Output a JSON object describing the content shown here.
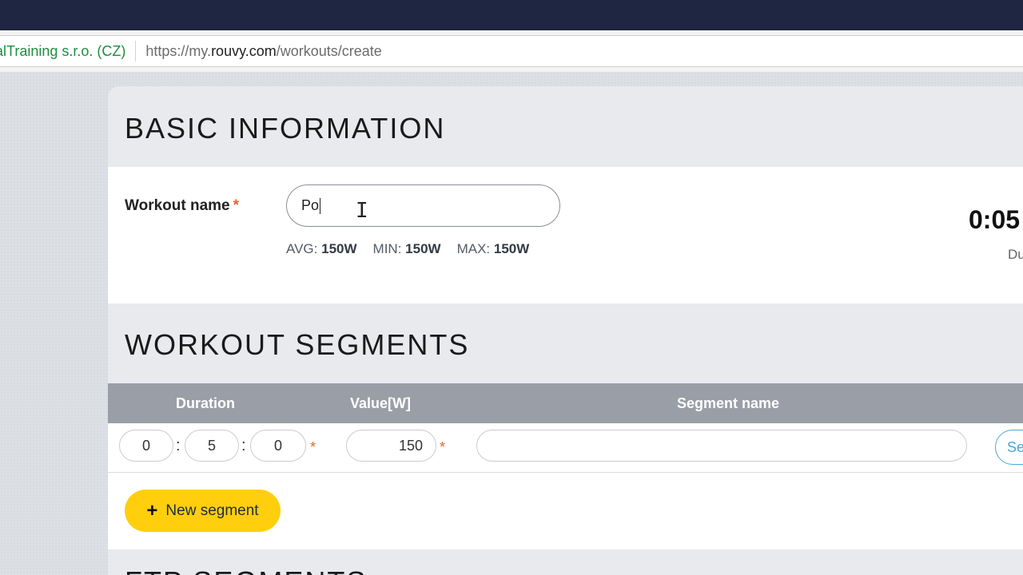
{
  "browser": {
    "site_identity": "alTraining s.r.o. (CZ)",
    "url_prefix": "https://my.",
    "url_host": "rouvy.com",
    "url_path": "/workouts/create"
  },
  "basic": {
    "title": "BASIC INFORMATION",
    "name_label": "Workout name",
    "required_mark": "*",
    "name_value": "Po",
    "stats": {
      "avg_label": "AVG:",
      "avg_value": "150W",
      "min_label": "MIN:",
      "min_value": "150W",
      "max_label": "MAX:",
      "max_value": "150W"
    },
    "duration_value": "0:05",
    "duration_label": "Du"
  },
  "segments": {
    "title": "WORKOUT SEGMENTS",
    "columns": {
      "duration": "Duration",
      "value": "Value[W]",
      "name": "Segment name"
    },
    "rows": [
      {
        "hours": "0",
        "minutes": "5",
        "seconds": "0",
        "value": "150",
        "name": "",
        "button": "Se"
      }
    ],
    "colon": ":",
    "new_segment_label": "New segment",
    "plus_icon": "+"
  },
  "ftp": {
    "title": "FTP SEGMENTS"
  },
  "colors": {
    "accent_yellow": "#ffcf0d",
    "required_orange": "#e8632b",
    "link_blue": "#4aa8d8",
    "header_gray": "#9a9ea7"
  }
}
